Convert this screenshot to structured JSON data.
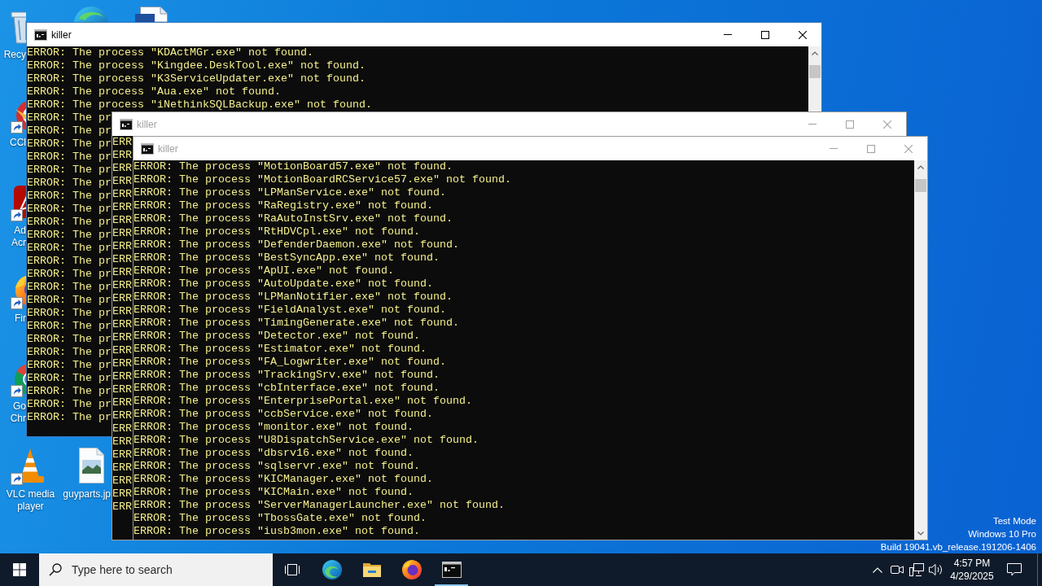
{
  "desktop_icons": [
    {
      "label": "Recy",
      "shortcut": false
    },
    {
      "label": "CCl",
      "shortcut": true
    },
    {
      "label": "Ad Acr",
      "shortcut": true
    },
    {
      "label": "Fir",
      "shortcut": true
    },
    {
      "label": "Go Chr",
      "shortcut": true
    },
    {
      "label": "VLC media player",
      "shortcut": true
    },
    {
      "label": "guyparts.jp",
      "shortcut": false
    }
  ],
  "windows": [
    {
      "title": "killer",
      "active": true,
      "lines": [
        "ERROR: The process \"KDActMGr.exe\" not found.",
        "ERROR: The process \"Kingdee.DeskTool.exe\" not found.",
        "ERROR: The process \"K3ServiceUpdater.exe\" not found.",
        "ERROR: The process \"Aua.exe\" not found.",
        "ERROR: The process \"iNethinkSQLBackup.exe\" not found.",
        "ERROR: The pr",
        "ERROR: The pr",
        "ERROR: The pr",
        "ERROR: The pr",
        "ERROR: The pr",
        "ERROR: The pr",
        "ERROR: The pr",
        "ERROR: The pr",
        "ERROR: The pr",
        "ERROR: The pr",
        "ERROR: The pr",
        "ERROR: The pr",
        "ERROR: The pr",
        "ERROR: The pr",
        "ERROR: The pr",
        "ERROR: The pr",
        "ERROR: The pr",
        "ERROR: The pr",
        "ERROR: The pr",
        "ERROR: The pr",
        "ERROR: The pr",
        "ERROR: The pr",
        "ERROR: The pr",
        "ERROR: The pr"
      ]
    },
    {
      "title": "killer",
      "active": false,
      "lines": [
        "ERR",
        "ERR",
        "ERR",
        "ERR",
        "ERR",
        "ERR",
        "ERR",
        "ERR",
        "ERR",
        "ERR",
        "ERR",
        "ERR",
        "ERR",
        "ERR",
        "ERR",
        "ERR",
        "ERR",
        "ERR",
        "ERR",
        "ERR",
        "ERR",
        "ERR",
        "ERR",
        "ERR",
        "ERR",
        "ERR",
        "ERR",
        "ERR",
        "ERR"
      ]
    },
    {
      "title": "killer",
      "active": false,
      "lines": [
        "ERROR: The process \"MotionBoard57.exe\" not found.",
        "ERROR: The process \"MotionBoardRCService57.exe\" not found.",
        "ERROR: The process \"LPManService.exe\" not found.",
        "ERROR: The process \"RaRegistry.exe\" not found.",
        "ERROR: The process \"RaAutoInstSrv.exe\" not found.",
        "ERROR: The process \"RtHDVCpl.exe\" not found.",
        "ERROR: The process \"DefenderDaemon.exe\" not found.",
        "ERROR: The process \"BestSyncApp.exe\" not found.",
        "ERROR: The process \"ApUI.exe\" not found.",
        "ERROR: The process \"AutoUpdate.exe\" not found.",
        "ERROR: The process \"LPManNotifier.exe\" not found.",
        "ERROR: The process \"FieldAnalyst.exe\" not found.",
        "ERROR: The process \"TimingGenerate.exe\" not found.",
        "ERROR: The process \"Detector.exe\" not found.",
        "ERROR: The process \"Estimator.exe\" not found.",
        "ERROR: The process \"FA_Logwriter.exe\" not found.",
        "ERROR: The process \"TrackingSrv.exe\" not found.",
        "ERROR: The process \"cbInterface.exe\" not found.",
        "ERROR: The process \"EnterprisePortal.exe\" not found.",
        "ERROR: The process \"ccbService.exe\" not found.",
        "ERROR: The process \"monitor.exe\" not found.",
        "ERROR: The process \"U8DispatchService.exe\" not found.",
        "ERROR: The process \"dbsrv16.exe\" not found.",
        "ERROR: The process \"sqlservr.exe\" not found.",
        "ERROR: The process \"KICManager.exe\" not found.",
        "ERROR: The process \"KICMain.exe\" not found.",
        "ERROR: The process \"ServerManagerLauncher.exe\" not found.",
        "ERROR: The process \"TbossGate.exe\" not found.",
        "ERROR: The process \"iusb3mon.exe\" not found."
      ]
    }
  ],
  "system_info": [
    "Test Mode",
    "Windows 10 Pro",
    "Build 19041.vb_release.191206-1406"
  ],
  "taskbar": {
    "search": {
      "placeholder": "Type here to search"
    },
    "apps": [
      {
        "running": false
      },
      {
        "running": false
      },
      {
        "running": false
      },
      {
        "running": true
      }
    ],
    "clock": {
      "time": "4:57 PM",
      "date": "4/29/2025"
    }
  }
}
